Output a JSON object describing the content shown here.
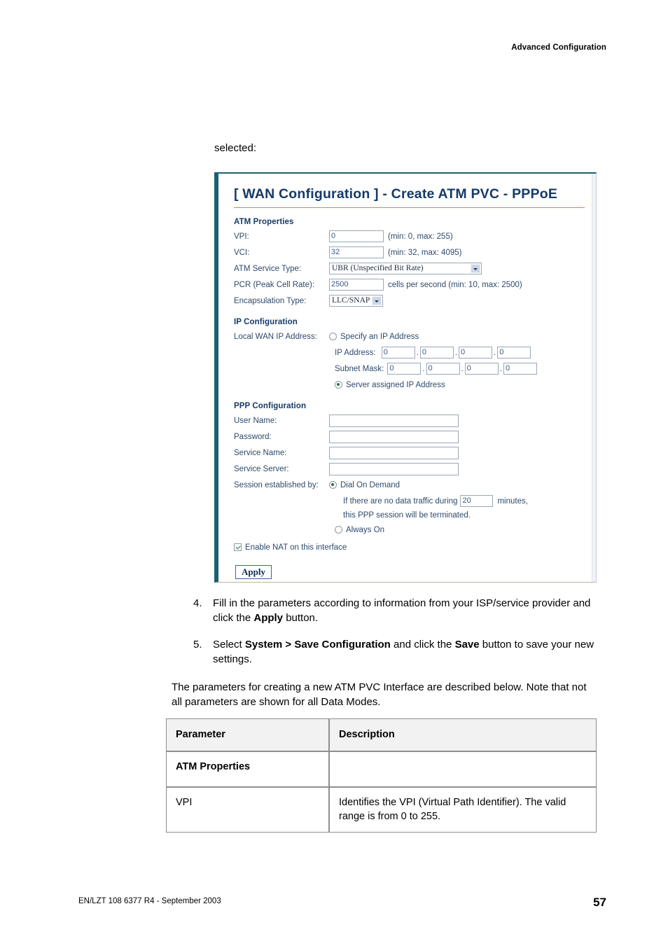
{
  "page": {
    "header": "Advanced Configuration",
    "lead_text": "selected:",
    "footer_left": "EN/LZT 108 6377 R4 - September 2003",
    "footer_page_number": "57"
  },
  "colors": {
    "frame_accent": "#1b6070",
    "title_blue": "#163a66",
    "rule_orange": "#e8841a",
    "form_label": "#2f4a6b",
    "radio_check_green": "#1f7a33"
  },
  "router_ui": {
    "title": "[ WAN Configuration ] - Create ATM PVC - PPPoE",
    "atm_properties": {
      "heading": "ATM Properties",
      "fields": [
        {
          "label": "VPI:",
          "value": "0",
          "hint": "(min: 0, max: 255)"
        },
        {
          "label": "VCI:",
          "value": "32",
          "hint": "(min: 32, max: 4095)"
        }
      ],
      "service_type": {
        "label": "ATM Service Type:",
        "selected": "UBR (Unspecified Bit Rate)"
      },
      "pcr": {
        "label": "PCR (Peak Cell Rate):",
        "value": "2500",
        "hint": "cells per second (min: 10, max: 2500)"
      },
      "encapsulation": {
        "label": "Encapsulation Type:",
        "selected": "LLC/SNAP"
      }
    },
    "ip_configuration": {
      "heading": "IP Configuration",
      "local_wan_label": "Local WAN IP Address:",
      "specify_option": "Specify an IP Address",
      "specify_selected": false,
      "ip_address_label": "IP Address:",
      "ip_address_octets": [
        "0",
        "0",
        "0",
        "0"
      ],
      "subnet_mask_label": "Subnet Mask:",
      "subnet_mask_octets": [
        "0",
        "0",
        "0",
        "0"
      ],
      "server_assigned_option": "Server assigned IP Address",
      "server_assigned_selected": true
    },
    "ppp_configuration": {
      "heading": "PPP Configuration",
      "fields": [
        {
          "label": "User Name:",
          "value": ""
        },
        {
          "label": "Password:",
          "value": ""
        },
        {
          "label": "Service Name:",
          "value": ""
        },
        {
          "label": "Service Server:",
          "value": ""
        }
      ],
      "session_label": "Session established by:",
      "dial_on_demand_option": "Dial On Demand",
      "dial_on_demand_selected": true,
      "idle_prefix": "If there are no data traffic during",
      "idle_minutes": "20",
      "idle_suffix": "minutes,",
      "idle_line2": "this PPP session will be terminated.",
      "always_on_option": "Always On",
      "always_on_selected": false,
      "nat_label": "Enable NAT on this interface",
      "nat_checked": true,
      "apply_button": "Apply"
    }
  },
  "steps": [
    {
      "number": "4.",
      "parts": [
        {
          "text": "Fill in the parameters according to information from your ISP/service provider and click the ",
          "bold": false
        },
        {
          "text": "Apply",
          "bold": true
        },
        {
          "text": " button.",
          "bold": false
        }
      ]
    },
    {
      "number": "5.",
      "parts": [
        {
          "text": "Select ",
          "bold": false
        },
        {
          "text": "System > Save Configuration",
          "bold": true
        },
        {
          "text": " and click the ",
          "bold": false
        },
        {
          "text": "Save",
          "bold": true
        },
        {
          "text": " button to save your new settings.",
          "bold": false
        }
      ]
    }
  ],
  "paragraph": "The parameters for creating a new ATM PVC Interface are described below. Note that not all parameters are shown for all Data Modes.",
  "param_table": {
    "headers": [
      "Parameter",
      "Description"
    ],
    "rows": [
      {
        "parameter": "ATM Properties",
        "description": "",
        "bold": true
      },
      {
        "parameter": "VPI",
        "description": "Identifies the VPI (Virtual Path Identifier). The valid range is from 0 to 255.",
        "bold": false
      }
    ]
  }
}
